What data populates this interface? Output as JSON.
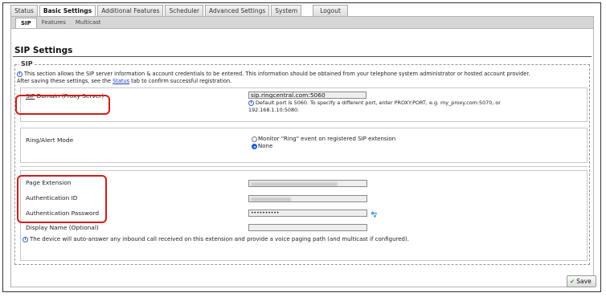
{
  "main_tabs": [
    {
      "label": "Status"
    },
    {
      "label": "Basic Settings"
    },
    {
      "label": "Additional Features"
    },
    {
      "label": "Scheduler"
    },
    {
      "label": "Advanced Settings"
    },
    {
      "label": "System"
    }
  ],
  "logout_label": "Logout",
  "sub_tabs": [
    {
      "label": "SIP"
    },
    {
      "label": "Features"
    },
    {
      "label": "Multicast"
    }
  ],
  "page_title": "SIP Settings",
  "sip_legend": "SIP",
  "info": {
    "line1": "This section allows the SIP server information & account credentials to be entered. This information should be obtained from your telephone system administrator or hosted account provider.",
    "line2_pre": "After saving these settings, see the ",
    "line2_link": "Status",
    "line2_post": " tab to confirm successful registration."
  },
  "sip_domain": {
    "label_underlined": "SIP",
    "label_rest": " Domain (Proxy Server)",
    "value": "sip.ringcentral.com:5060",
    "hint1": "Default port is 5060. To specify a different port, enter PROXY:PORT, e.g. my_proxy.com:5070, or",
    "hint2": "192.168.1.10:5080."
  },
  "ring_alert": {
    "label": "Ring/Alert Mode",
    "option1": "Monitor \"Ring\" event on registered SIP extension",
    "option2": "None",
    "selected": "None"
  },
  "page_extension": {
    "label": "Page Extension"
  },
  "auth_id": {
    "label": "Authentication ID"
  },
  "auth_password": {
    "label": "Authentication Password",
    "value": "••••••••••"
  },
  "display_name": {
    "label": "Display Name (Optional)",
    "value": ""
  },
  "auto_answer_note": "The device will auto-answer any inbound call received on this extension and provide a voice paging path (and multicast if configured).",
  "save_label": "Save",
  "colors": {
    "highlight_red": "#d41a1a",
    "link_blue": "#1a3fbf",
    "tab_gray": "#d6d6d6"
  }
}
